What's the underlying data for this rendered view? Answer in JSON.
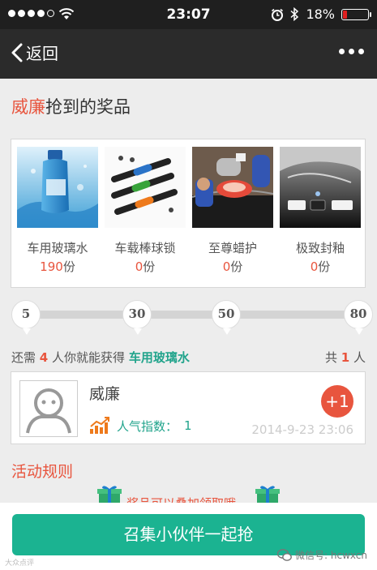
{
  "status_bar": {
    "time": "23:07",
    "battery_percent": "18%",
    "battery_level": 0.18,
    "signal_bars_filled": 4,
    "signal_bars_total": 5
  },
  "nav": {
    "back_label": "返回"
  },
  "prize_section": {
    "winner_name": "威廉",
    "title_suffix": "抢到的奖品",
    "items": [
      {
        "name": "车用玻璃水",
        "count": "190",
        "unit": "份",
        "icon": "washer-fluid-bottle"
      },
      {
        "name": "车载棒球锁",
        "count": "0",
        "unit": "份",
        "icon": "steering-lock"
      },
      {
        "name": "至尊蜡护",
        "count": "0",
        "unit": "份",
        "icon": "car-polishing"
      },
      {
        "name": "极致封釉",
        "count": "0",
        "unit": "份",
        "icon": "car-glaze"
      }
    ]
  },
  "progress": {
    "milestones": [
      "5",
      "30",
      "50",
      "80"
    ]
  },
  "need": {
    "prefix": "还需",
    "count": "4",
    "middle": "人你就能获得",
    "prize": "车用玻璃水"
  },
  "total": {
    "prefix": "共",
    "count": "1",
    "suffix": "人"
  },
  "member": {
    "name": "威廉",
    "popularity_label": "人气指数：",
    "popularity_value": "1",
    "plus_label": "+1",
    "time": "2014-9-23 23:06"
  },
  "rules": {
    "title": "活动规则",
    "text": "奖品可以叠加领取哦"
  },
  "cta": {
    "label": "召集小伙伴一起抢"
  },
  "watermark": {
    "left": "大众点评",
    "right": "微信号: hcwxcn"
  },
  "colors": {
    "accent_red": "#e8553e",
    "accent_teal": "#22a48c",
    "cta_green": "#1bb391",
    "nav_bg": "#2b2b2b"
  }
}
